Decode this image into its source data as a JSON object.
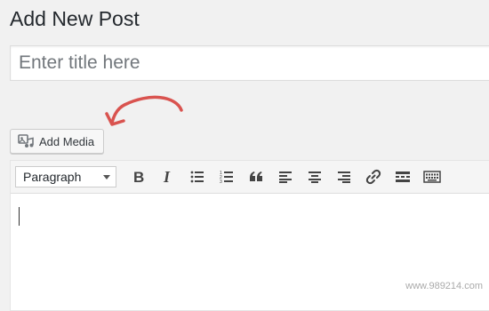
{
  "page": {
    "title": "Add New Post"
  },
  "title_field": {
    "value": "",
    "placeholder": "Enter title here"
  },
  "media": {
    "add_media_label": "Add Media"
  },
  "toolbar": {
    "format_select_value": "Paragraph",
    "buttons": [
      {
        "name": "bold",
        "icon": "bold-icon"
      },
      {
        "name": "italic",
        "icon": "italic-icon"
      },
      {
        "name": "bulleted-list",
        "icon": "bulleted-list-icon"
      },
      {
        "name": "numbered-list",
        "icon": "numbered-list-icon"
      },
      {
        "name": "blockquote",
        "icon": "blockquote-icon"
      },
      {
        "name": "align-left",
        "icon": "align-left-icon"
      },
      {
        "name": "align-center",
        "icon": "align-center-icon"
      },
      {
        "name": "align-right",
        "icon": "align-right-icon"
      },
      {
        "name": "insert-link",
        "icon": "link-icon"
      },
      {
        "name": "read-more",
        "icon": "read-more-icon"
      },
      {
        "name": "toolbar-toggle",
        "icon": "keyboard-icon"
      }
    ]
  },
  "colors": {
    "annotation_arrow": "#d9534f"
  },
  "watermark": "www.989214.com"
}
